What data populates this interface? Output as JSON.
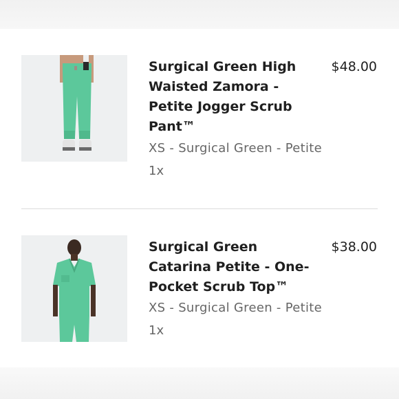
{
  "cart": {
    "items": [
      {
        "title": "Surgical Green High Waisted Zamora - Petite Jogger Scrub Pant™",
        "price": "$48.00",
        "variant": "XS - Surgical Green - Petite",
        "quantity": "1x",
        "image": "scrub-pant-product-photo",
        "color": "#5cc89b"
      },
      {
        "title": "Surgical Green Catarina Petite - One-Pocket Scrub Top™",
        "price": "$38.00",
        "variant": "XS - Surgical Green - Petite",
        "quantity": "1x",
        "image": "scrub-top-product-photo",
        "color": "#5cc89b"
      }
    ]
  }
}
